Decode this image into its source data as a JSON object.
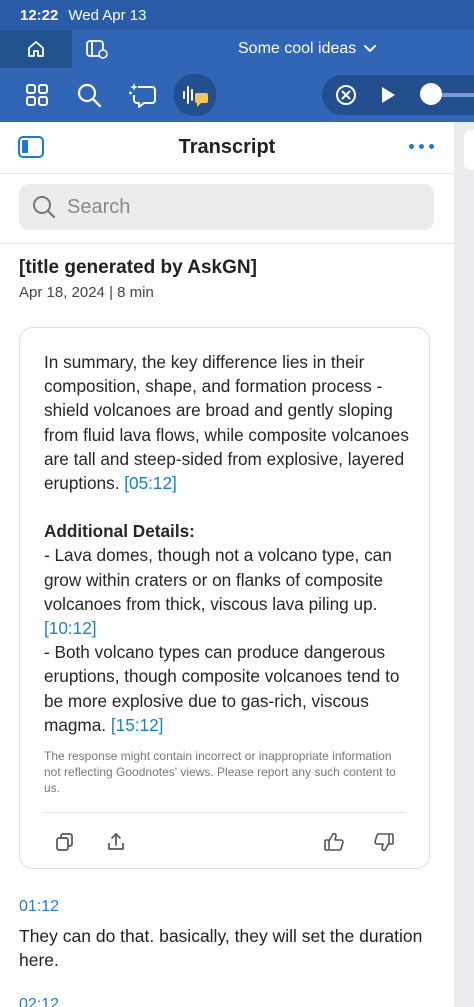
{
  "status": {
    "time": "12:22",
    "date": "Wed Apr 13"
  },
  "nav": {
    "document_title": "Some cool ideas"
  },
  "toolbar": {
    "icons": [
      "grid-icon",
      "search-icon",
      "ai-sparkle-chat-icon",
      "audio-transcript-icon"
    ],
    "player_icons": [
      "close-circle-icon",
      "play-icon"
    ]
  },
  "panel": {
    "title": "Transcript",
    "search_placeholder": "Search",
    "note_title": "[title generated by AskGN]",
    "note_meta": "Apr 18, 2024 | 8 min"
  },
  "summary": {
    "para1": "In summary, the key difference lies in their composition, shape, and formation process - shield volcanoes are broad and gently sloping from fluid lava flows, while composite volcanoes are tall and steep-sided from explosive, layered eruptions.",
    "para1_ts": "[05:12]",
    "details_heading": "Additional Details:",
    "detail1": "- Lava domes, though not a volcano type, can grow within craters or on flanks of composite volcanoes from thick, viscous lava piling up.",
    "detail1_ts": "[10:12]",
    "detail2": "- Both volcano types can produce dangerous eruptions, though composite volcanoes tend to be more explosive due to gas-rich, viscous magma.",
    "detail2_ts": "[15:12]",
    "disclaimer": "The response might contain incorrect or inappropriate information not reflecting Goodnotes' views. Please report any such content to us."
  },
  "segments": [
    {
      "time": "01:12",
      "text": "They can do that. basically, they will set the duration here."
    },
    {
      "time": "02:12",
      "text": ""
    }
  ],
  "colors": {
    "chrome_blue": "#3066b5",
    "accent_blue": "#1b80c9"
  }
}
